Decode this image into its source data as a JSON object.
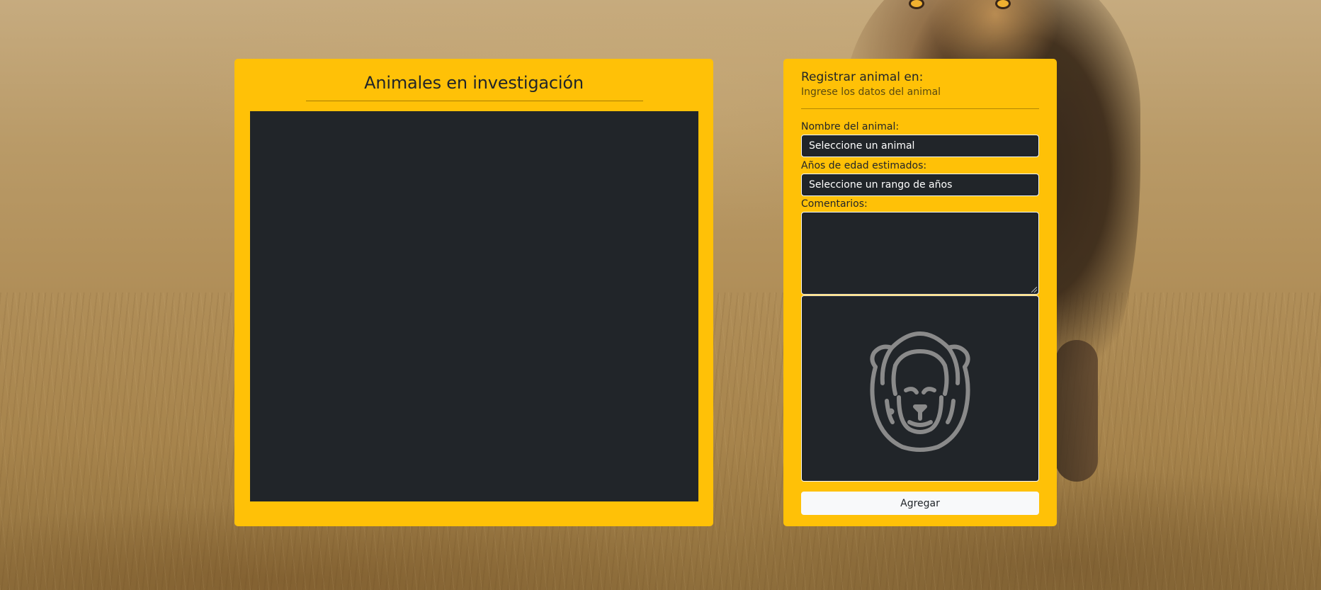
{
  "background": {
    "image_subject": "lion-in-savanna"
  },
  "left_panel": {
    "title": "Animales en investigación"
  },
  "form": {
    "title": "Registrar animal en:",
    "subtitle": "Ingrese los datos del animal",
    "name_label": "Nombre del animal:",
    "name_select_value": "Seleccione un animal",
    "age_label": "Años de edad estimados:",
    "age_select_value": "Seleccione un rango de años",
    "comments_label": "Comentarios:",
    "comments_value": "",
    "preview_icon": "lion-icon",
    "add_button_label": "Agregar"
  },
  "colors": {
    "panel": "#ffc107",
    "dark": "#212529",
    "button": "#f8f9fa",
    "icon_stroke": "#8a8a8a"
  }
}
